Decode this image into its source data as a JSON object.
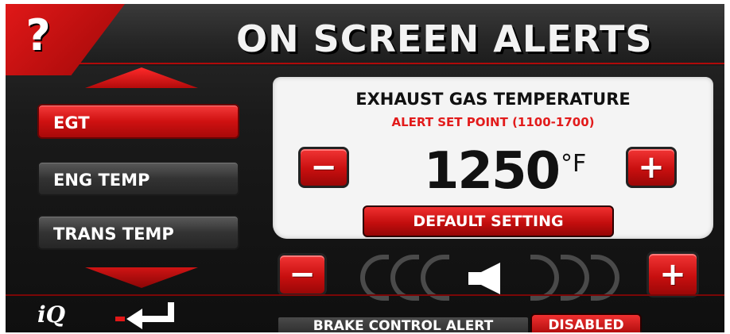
{
  "header": {
    "title": "ON SCREEN ALERTS",
    "help_glyph": "?"
  },
  "alert_list": {
    "items": [
      {
        "label": "EGT",
        "selected": true
      },
      {
        "label": "ENG TEMP",
        "selected": false
      },
      {
        "label": "TRANS TEMP",
        "selected": false
      }
    ]
  },
  "alert_panel": {
    "title": "EXHAUST GAS TEMPERATURE",
    "subtitle": "ALERT SET POINT (1100-1700)",
    "value": "1250",
    "unit": "°F",
    "decrease_glyph": "−",
    "increase_glyph": "+",
    "default_button": "DEFAULT SETTING"
  },
  "volume": {
    "decrease_glyph": "−",
    "increase_glyph": "+",
    "level": 0
  },
  "footer": {
    "logo": "iQ",
    "brake_label": "BRAKE CONTROL ALERT",
    "brake_value": "DISABLED"
  },
  "colors": {
    "accent": "#d41212",
    "panel_bg": "#f4f4f4",
    "alert_text": "#e21b1b"
  },
  "icons": {
    "help": "question-mark-icon",
    "scroll_up": "triangle-up-icon",
    "scroll_down": "triangle-down-icon",
    "volume": "speaker-icon",
    "back": "return-arrow-icon"
  }
}
